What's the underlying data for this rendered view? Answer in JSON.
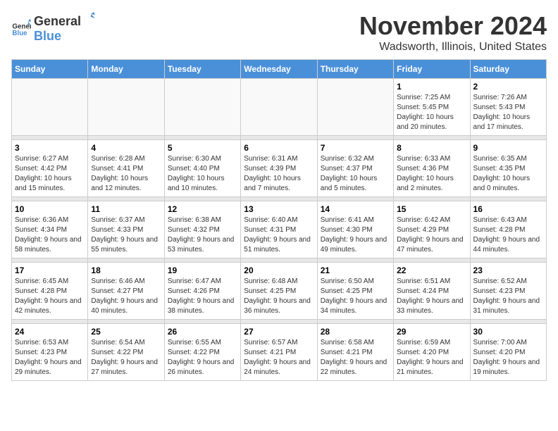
{
  "header": {
    "logo_general": "General",
    "logo_blue": "Blue",
    "month": "November 2024",
    "location": "Wadsworth, Illinois, United States"
  },
  "weekdays": [
    "Sunday",
    "Monday",
    "Tuesday",
    "Wednesday",
    "Thursday",
    "Friday",
    "Saturday"
  ],
  "weeks": [
    [
      {
        "day": "",
        "info": ""
      },
      {
        "day": "",
        "info": ""
      },
      {
        "day": "",
        "info": ""
      },
      {
        "day": "",
        "info": ""
      },
      {
        "day": "",
        "info": ""
      },
      {
        "day": "1",
        "info": "Sunrise: 7:25 AM\nSunset: 5:45 PM\nDaylight: 10 hours and 20 minutes."
      },
      {
        "day": "2",
        "info": "Sunrise: 7:26 AM\nSunset: 5:43 PM\nDaylight: 10 hours and 17 minutes."
      }
    ],
    [
      {
        "day": "3",
        "info": "Sunrise: 6:27 AM\nSunset: 4:42 PM\nDaylight: 10 hours and 15 minutes."
      },
      {
        "day": "4",
        "info": "Sunrise: 6:28 AM\nSunset: 4:41 PM\nDaylight: 10 hours and 12 minutes."
      },
      {
        "day": "5",
        "info": "Sunrise: 6:30 AM\nSunset: 4:40 PM\nDaylight: 10 hours and 10 minutes."
      },
      {
        "day": "6",
        "info": "Sunrise: 6:31 AM\nSunset: 4:39 PM\nDaylight: 10 hours and 7 minutes."
      },
      {
        "day": "7",
        "info": "Sunrise: 6:32 AM\nSunset: 4:37 PM\nDaylight: 10 hours and 5 minutes."
      },
      {
        "day": "8",
        "info": "Sunrise: 6:33 AM\nSunset: 4:36 PM\nDaylight: 10 hours and 2 minutes."
      },
      {
        "day": "9",
        "info": "Sunrise: 6:35 AM\nSunset: 4:35 PM\nDaylight: 10 hours and 0 minutes."
      }
    ],
    [
      {
        "day": "10",
        "info": "Sunrise: 6:36 AM\nSunset: 4:34 PM\nDaylight: 9 hours and 58 minutes."
      },
      {
        "day": "11",
        "info": "Sunrise: 6:37 AM\nSunset: 4:33 PM\nDaylight: 9 hours and 55 minutes."
      },
      {
        "day": "12",
        "info": "Sunrise: 6:38 AM\nSunset: 4:32 PM\nDaylight: 9 hours and 53 minutes."
      },
      {
        "day": "13",
        "info": "Sunrise: 6:40 AM\nSunset: 4:31 PM\nDaylight: 9 hours and 51 minutes."
      },
      {
        "day": "14",
        "info": "Sunrise: 6:41 AM\nSunset: 4:30 PM\nDaylight: 9 hours and 49 minutes."
      },
      {
        "day": "15",
        "info": "Sunrise: 6:42 AM\nSunset: 4:29 PM\nDaylight: 9 hours and 47 minutes."
      },
      {
        "day": "16",
        "info": "Sunrise: 6:43 AM\nSunset: 4:28 PM\nDaylight: 9 hours and 44 minutes."
      }
    ],
    [
      {
        "day": "17",
        "info": "Sunrise: 6:45 AM\nSunset: 4:28 PM\nDaylight: 9 hours and 42 minutes."
      },
      {
        "day": "18",
        "info": "Sunrise: 6:46 AM\nSunset: 4:27 PM\nDaylight: 9 hours and 40 minutes."
      },
      {
        "day": "19",
        "info": "Sunrise: 6:47 AM\nSunset: 4:26 PM\nDaylight: 9 hours and 38 minutes."
      },
      {
        "day": "20",
        "info": "Sunrise: 6:48 AM\nSunset: 4:25 PM\nDaylight: 9 hours and 36 minutes."
      },
      {
        "day": "21",
        "info": "Sunrise: 6:50 AM\nSunset: 4:25 PM\nDaylight: 9 hours and 34 minutes."
      },
      {
        "day": "22",
        "info": "Sunrise: 6:51 AM\nSunset: 4:24 PM\nDaylight: 9 hours and 33 minutes."
      },
      {
        "day": "23",
        "info": "Sunrise: 6:52 AM\nSunset: 4:23 PM\nDaylight: 9 hours and 31 minutes."
      }
    ],
    [
      {
        "day": "24",
        "info": "Sunrise: 6:53 AM\nSunset: 4:23 PM\nDaylight: 9 hours and 29 minutes."
      },
      {
        "day": "25",
        "info": "Sunrise: 6:54 AM\nSunset: 4:22 PM\nDaylight: 9 hours and 27 minutes."
      },
      {
        "day": "26",
        "info": "Sunrise: 6:55 AM\nSunset: 4:22 PM\nDaylight: 9 hours and 26 minutes."
      },
      {
        "day": "27",
        "info": "Sunrise: 6:57 AM\nSunset: 4:21 PM\nDaylight: 9 hours and 24 minutes."
      },
      {
        "day": "28",
        "info": "Sunrise: 6:58 AM\nSunset: 4:21 PM\nDaylight: 9 hours and 22 minutes."
      },
      {
        "day": "29",
        "info": "Sunrise: 6:59 AM\nSunset: 4:20 PM\nDaylight: 9 hours and 21 minutes."
      },
      {
        "day": "30",
        "info": "Sunrise: 7:00 AM\nSunset: 4:20 PM\nDaylight: 9 hours and 19 minutes."
      }
    ]
  ]
}
